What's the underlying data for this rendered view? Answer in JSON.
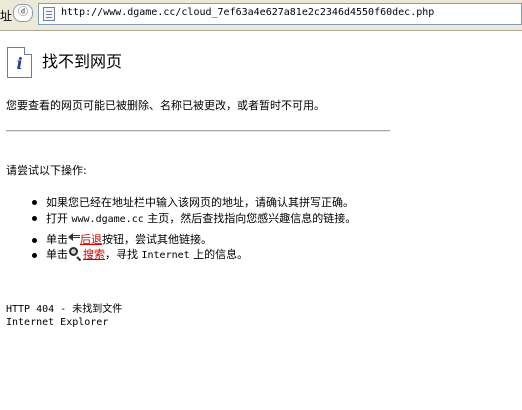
{
  "address_bar": {
    "label": "址",
    "dropdown_label": "ⓓ",
    "url": "http://www.dgame.cc/cloud_7ef63a4e627a81e2c2346d4550f60dec.php"
  },
  "page": {
    "title": "找不到网页",
    "description": "您要查看的网页可能已被删除、名称已被更改，或者暂时不可用。",
    "try_label": "请尝试以下操作:",
    "item1": "如果您已经在地址栏中输入该网页的地址，请确认其拼写正确。",
    "item2_prefix": "打开",
    "item2_link": "www.dgame.cc",
    "item2_suffix": "主页，然后查找指向您感兴趣信息的链接。",
    "item3_prefix": "单击",
    "item3_link": "后退",
    "item3_suffix": "按钮，尝试其他链接。",
    "item4_prefix": "单击",
    "item4_link": "搜索",
    "item4_mid": "，寻找",
    "item4_word": "Internet",
    "item4_suffix": "上的信息。",
    "error_code": "HTTP 404 - 未找到文件",
    "browser_name": "Internet Explorer"
  },
  "icons": {
    "info": "info-icon",
    "back": "back-arrow-icon",
    "search": "search-icon",
    "page": "page-icon"
  },
  "colors": {
    "link_red": "#cc0000",
    "toolbar_bg": "#ece9d8"
  }
}
